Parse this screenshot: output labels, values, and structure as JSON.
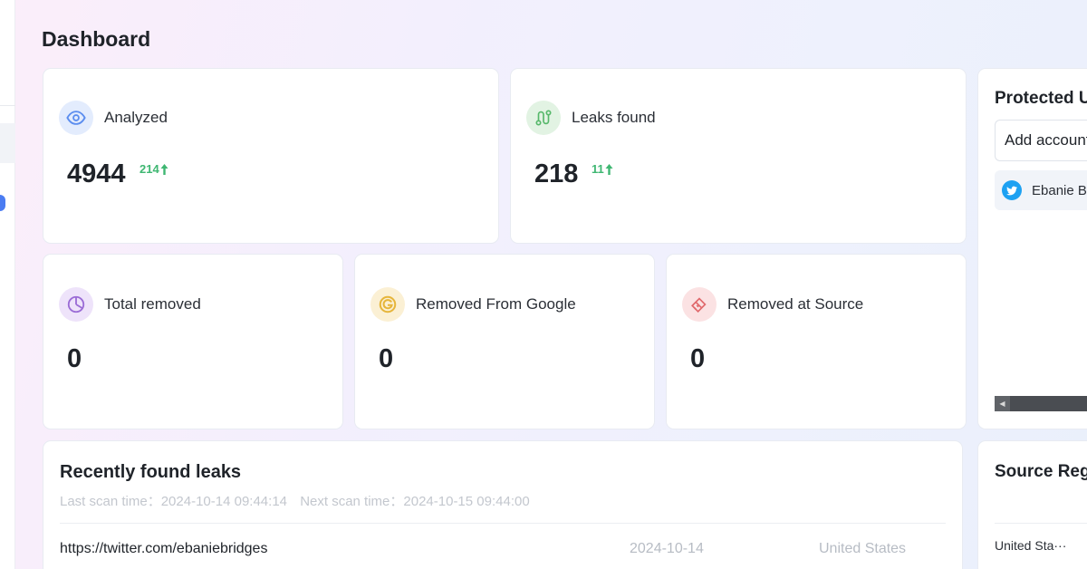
{
  "page": {
    "title": "Dashboard"
  },
  "stats_top": [
    {
      "label": "Analyzed",
      "value": "4944",
      "delta": "214",
      "icon": "eye-icon",
      "color": "#5b8def"
    },
    {
      "label": "Leaks found",
      "value": "218",
      "delta": "11",
      "icon": "leak-path-icon",
      "color": "#56b86a"
    }
  ],
  "stats_bottom": [
    {
      "label": "Total removed",
      "value": "0",
      "icon": "pie-chart-icon",
      "color": "#9b6cd6"
    },
    {
      "label": "Removed From Google",
      "value": "0",
      "icon": "google-icon",
      "color": "#e6b53a"
    },
    {
      "label": "Removed at Source",
      "value": "0",
      "icon": "eraser-icon",
      "color": "#e0676a"
    }
  ],
  "protected": {
    "title": "Protected U",
    "add_account": "Add account",
    "accounts": [
      {
        "name": "Ebanie Br",
        "icon": "twitter-icon"
      }
    ]
  },
  "recent_leaks": {
    "title": "Recently found leaks",
    "last_scan_label": "Last scan time：",
    "last_scan": "2024-10-14 09:44:14",
    "next_scan_label": "Next scan time：",
    "next_scan": "2024-10-15 09:44:00",
    "rows": [
      {
        "url": "https://twitter.com/ebaniebridges",
        "date": "2024-10-14",
        "region": "United States"
      }
    ]
  },
  "source_regions": {
    "title": "Source Reg",
    "items": [
      "United Sta···"
    ]
  },
  "colors": {
    "delta_up": "#3fb772",
    "accent": "#4b7cf2"
  }
}
